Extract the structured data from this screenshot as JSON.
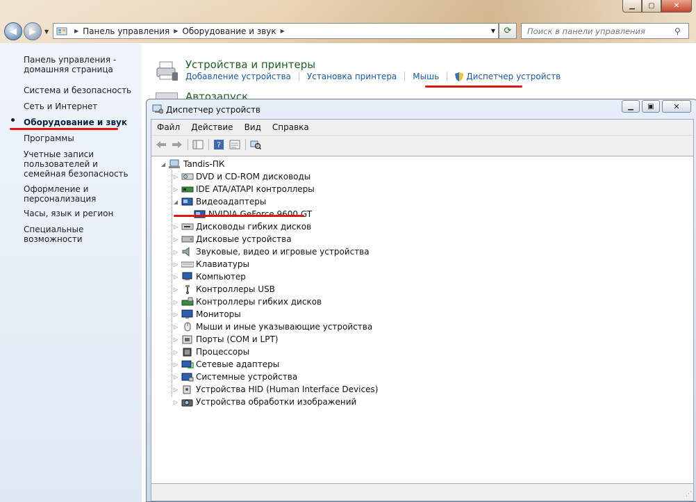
{
  "control_panel": {
    "address": {
      "crumbs": [
        "Панель управления",
        "Оборудование и звук"
      ]
    },
    "search": {
      "placeholder": "Поиск в панели управления"
    },
    "left_nav": [
      {
        "label": "Панель управления - домашняя страница",
        "active": false
      },
      {
        "label": "Система и безопасность",
        "active": false
      },
      {
        "label": "Сеть и Интернет",
        "active": false
      },
      {
        "label": "Оборудование и звук",
        "active": true
      },
      {
        "label": "Программы",
        "active": false
      },
      {
        "label": "Учетные записи пользователей и семейная безопасность",
        "active": false
      },
      {
        "label": "Оформление и персонализация",
        "active": false
      },
      {
        "label": "Часы, язык и регион",
        "active": false
      },
      {
        "label": "Специальные возможности",
        "active": false
      }
    ],
    "category": {
      "title": "Устройства и принтеры",
      "links": [
        "Добавление устройства",
        "Установка принтера",
        "Мышь",
        "Диспетчер устройств"
      ]
    },
    "category2": {
      "title": "Автозапуск"
    }
  },
  "device_manager": {
    "title": "Диспетчер устройств",
    "menu": [
      "Файл",
      "Действие",
      "Вид",
      "Справка"
    ],
    "root": "Tandis-ПК",
    "items": [
      {
        "label": "DVD и CD-ROM дисководы",
        "icon": "dvd-drive-icon"
      },
      {
        "label": "IDE ATA/ATAPI контроллеры",
        "icon": "ide-controller-icon"
      },
      {
        "label": "Видеоадаптеры",
        "icon": "display-adapter-icon",
        "expanded": true,
        "children": [
          {
            "label": "NVIDIA GeForce 9600 GT",
            "icon": "gpu-icon"
          }
        ]
      },
      {
        "label": "Дисководы гибких дисков",
        "icon": "floppy-drive-icon"
      },
      {
        "label": "Дисковые устройства",
        "icon": "disk-drive-icon"
      },
      {
        "label": "Звуковые, видео и игровые устройства",
        "icon": "speaker-icon"
      },
      {
        "label": "Клавиатуры",
        "icon": "keyboard-icon"
      },
      {
        "label": "Компьютер",
        "icon": "computer-icon"
      },
      {
        "label": "Контроллеры USB",
        "icon": "usb-icon"
      },
      {
        "label": "Контроллеры гибких дисков",
        "icon": "floppy-controller-icon"
      },
      {
        "label": "Мониторы",
        "icon": "monitor-icon"
      },
      {
        "label": "Мыши и иные указывающие устройства",
        "icon": "mouse-icon"
      },
      {
        "label": "Порты (COM и LPT)",
        "icon": "port-icon"
      },
      {
        "label": "Процессоры",
        "icon": "processor-icon"
      },
      {
        "label": "Сетевые адаптеры",
        "icon": "network-adapter-icon"
      },
      {
        "label": "Системные устройства",
        "icon": "system-device-icon"
      },
      {
        "label": "Устройства HID (Human Interface Devices)",
        "icon": "hid-icon"
      },
      {
        "label": "Устройства обработки изображений",
        "icon": "imaging-device-icon"
      }
    ]
  },
  "colors": {
    "highlight_underline": "#e11515",
    "link": "#1c5aa6",
    "category_title": "#1e5f26"
  }
}
